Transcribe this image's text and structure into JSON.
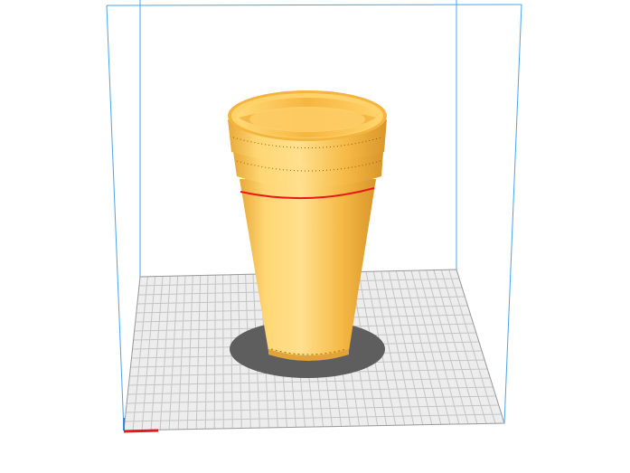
{
  "app": {
    "view": "slicer-3d-preview"
  },
  "colors": {
    "background": "#ffffff",
    "build_volume_edge": "#4aa3e8",
    "plate_fill": "#ededed",
    "plate_grid": "#c4c4c4",
    "plate_outline": "#9a9a9a",
    "model_base": "#f7bf4d",
    "model_light": "#ffe08e",
    "model_dark": "#d9962a",
    "shadow": "#5e5e5e",
    "seam_line": "#e81818",
    "axis_x": "#e81818"
  },
  "model": {
    "name_icon": "cup-model",
    "shape": "stacked-cups"
  },
  "icons": {
    "origin": "origin-axes-icon"
  }
}
